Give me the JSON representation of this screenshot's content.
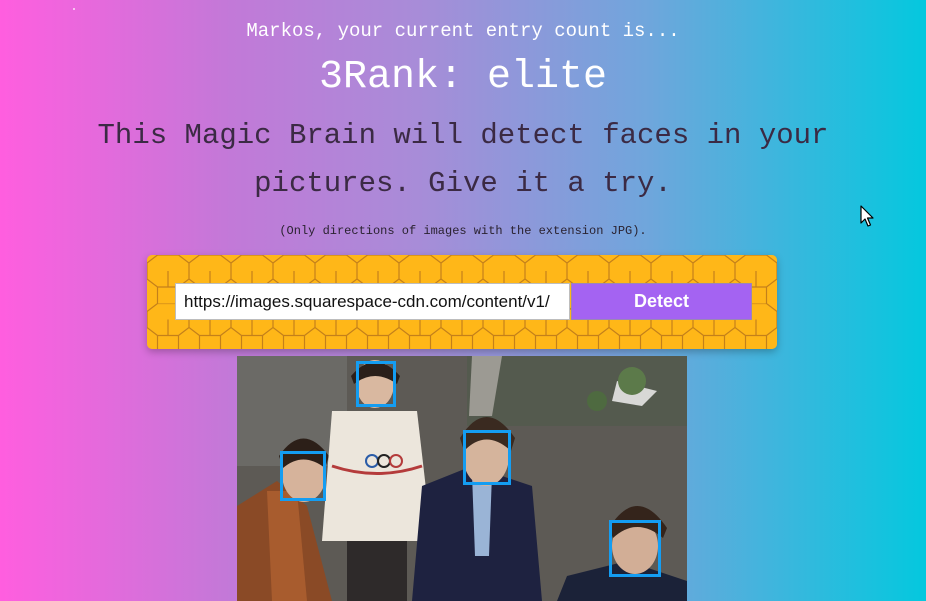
{
  "header": {
    "greeting": "Markos, your current entry count is...",
    "rank": "3Rank: elite"
  },
  "intro": {
    "tagline": "This Magic Brain will detect faces in your pictures. Give it a try.",
    "note": "(Only directions of images with the extension JPG)."
  },
  "form": {
    "url_value": "https://images.squarespace-cdn.com/content/v1/",
    "detect_label": "Detect"
  },
  "result": {
    "face_count": 4
  },
  "colors": {
    "accent_button": "#a463f2",
    "panel": "#ffb718",
    "face_box": "#149df2"
  },
  "icons": {
    "cursor": "mouse-pointer-icon"
  }
}
